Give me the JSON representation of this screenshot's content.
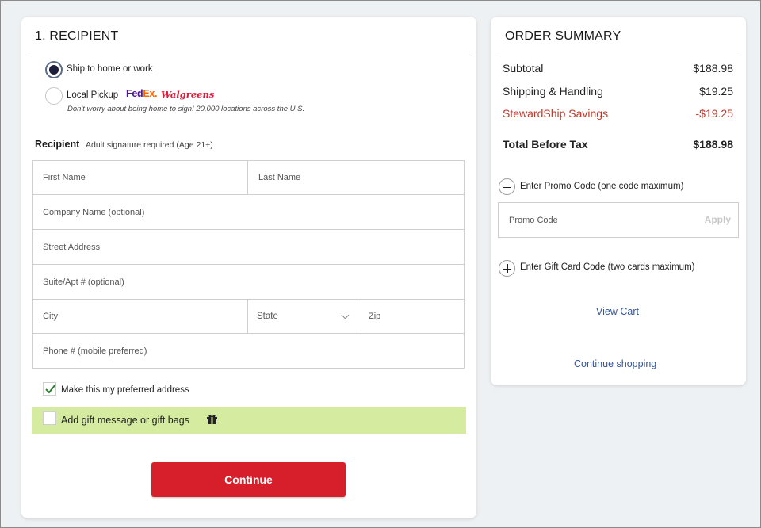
{
  "recipient": {
    "title": "1. RECIPIENT",
    "options": {
      "ship": "Ship to home or work",
      "pickup": "Local Pickup",
      "fedex_fed": "Fed",
      "fedex_ex": "Ex.",
      "walgreens": "Walgreens",
      "pickup_note": "Don't worry about being home to sign! 20,000 locations across the U.S."
    },
    "heading": "Recipient",
    "heading_sub": "Adult signature required (Age 21+)",
    "fields": {
      "first_name": "First Name",
      "last_name": "Last Name",
      "company": "Company Name (optional)",
      "street": "Street Address",
      "suite": "Suite/Apt # (optional)",
      "city": "City",
      "state": "State",
      "zip": "Zip",
      "phone": "Phone # (mobile preferred)"
    },
    "preferred_label": "Make this my preferred address",
    "gift_label": "Add gift message or gift bags",
    "continue_label": "Continue"
  },
  "summary": {
    "title": "ORDER SUMMARY",
    "subtotal_label": "Subtotal",
    "subtotal_value": "$188.98",
    "shipping_label": "Shipping & Handling",
    "shipping_value": "$19.25",
    "savings_label": "StewardShip Savings",
    "savings_value": "-$19.25",
    "total_label": "Total Before Tax",
    "total_value": "$188.98",
    "promo_toggle_label": "Enter Promo Code (one code maximum)",
    "promo_placeholder": "Promo Code",
    "apply_label": "Apply",
    "giftcard_toggle_label": "Enter Gift Card Code (two cards maximum)",
    "view_cart": "View Cart",
    "continue_shopping": "Continue shopping"
  },
  "colors": {
    "accent_red": "#d71f2b",
    "savings_red": "#c0392b",
    "link_blue": "#33569b",
    "gift_row_green": "#d4eba0"
  }
}
